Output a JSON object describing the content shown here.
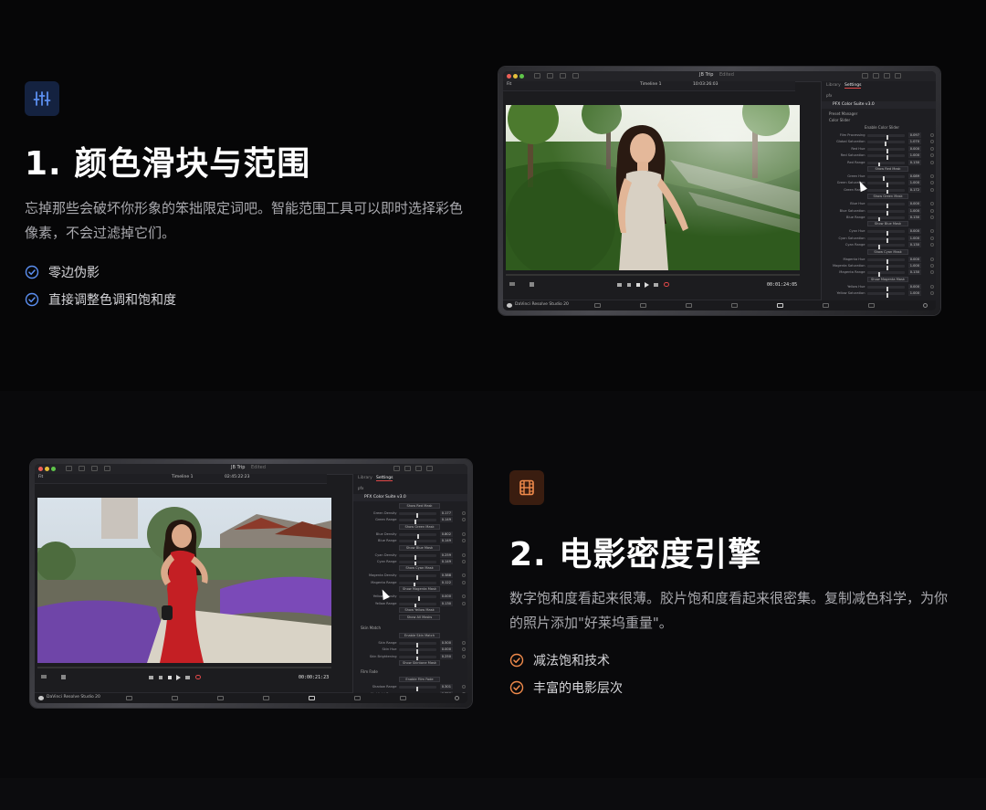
{
  "feature1": {
    "title": "1. 颜色滑块与范围",
    "description": "忘掉那些会破坏你形象的笨拙限定词吧。智能范围工具可以即时选择彩色像素，不会过滤掉它们。",
    "bullets": [
      "零边伪影",
      "直接调整色调和饱和度"
    ],
    "icon": "sliders-icon",
    "icon_color": "#5b8ff0",
    "icon_bg": "#142240",
    "check_color": "#5b8ff0"
  },
  "feature2": {
    "title": "2. 电影密度引擎",
    "description": "数字饱和度看起来很薄。胶片饱和度看起来很密集。复制减色科学，为你的照片添加\"好莱坞重量\"。",
    "bullets": [
      "减法饱和技术",
      "丰富的电影层次"
    ],
    "icon": "film-icon",
    "icon_color": "#f08a4b",
    "icon_bg": "#3a1d10",
    "check_color": "#f08a4b"
  },
  "app1": {
    "window_title": "JB Trip",
    "window_subtitle": "Edited",
    "timeline": "Timeline 1",
    "timecode_top": "10:03:26:03",
    "timecode": "00:01:24:05",
    "app_name": "DaVinci Resolve Studio 20",
    "tab_library": "Library",
    "tab_settings": "Settings",
    "fx_label": "pfx",
    "plugin_title": "PFX Color Suite v3.0",
    "preset_label": "Preset Manager",
    "section_label": "Color Slider",
    "enable_label": "Enable Color Slider",
    "rows": [
      {
        "label": "Film Processing",
        "value": "0.097"
      },
      {
        "label": "Global Saturation",
        "value": "1.070"
      },
      {
        "label": "Red Hue",
        "value": "0.000"
      },
      {
        "label": "Red Saturation",
        "value": "1.000"
      },
      {
        "label": "Red Range",
        "value": "0.130"
      },
      {
        "label": "Green Hue",
        "value": "0.089"
      },
      {
        "label": "Green Saturation",
        "value": "1.000"
      },
      {
        "label": "Green Range",
        "value": "0.172"
      },
      {
        "label": "Blue Hue",
        "value": "0.000"
      },
      {
        "label": "Blue Saturation",
        "value": "1.000"
      },
      {
        "label": "Blue Range",
        "value": "0.130"
      },
      {
        "label": "Cyan Hue",
        "value": "0.000"
      },
      {
        "label": "Cyan Saturation",
        "value": "1.000"
      },
      {
        "label": "Cyan Range",
        "value": "0.130"
      },
      {
        "label": "Magenta Hue",
        "value": "0.000"
      },
      {
        "label": "Magenta Saturation",
        "value": "1.000"
      },
      {
        "label": "Magenta Range",
        "value": "0.130"
      },
      {
        "label": "Yellow Hue",
        "value": "0.000"
      },
      {
        "label": "Yellow Saturation",
        "value": "1.000"
      }
    ],
    "masks": [
      "Show Red Mask",
      "Show Green Mask",
      "Show Blue Mask",
      "Show Cyan Mask",
      "Show Magenta Mask"
    ]
  },
  "app2": {
    "window_title": "JB Trip",
    "window_subtitle": "Edited",
    "timeline": "Timeline 1",
    "timecode_top": "02:45:22:23",
    "timecode": "00:00:21:23",
    "app_name": "DaVinci Resolve Studio 20",
    "tab_library": "Library",
    "tab_settings": "Settings",
    "fx_label": "pfx",
    "plugin_title": "PFX Color Suite v3.0",
    "rows": [
      {
        "label": "Green Density",
        "value": "0.177"
      },
      {
        "label": "Green Range",
        "value": "0.149"
      },
      {
        "label": "Blue Density",
        "value": "0.802"
      },
      {
        "label": "Blue Range",
        "value": "0.149"
      },
      {
        "label": "Cyan Density",
        "value": "0.259"
      },
      {
        "label": "Cyan Range",
        "value": "0.149"
      },
      {
        "label": "Magenta Density",
        "value": "0.388"
      },
      {
        "label": "Magenta Range",
        "value": "0.122"
      },
      {
        "label": "Yellow Density",
        "value": "0.000"
      },
      {
        "label": "Yellow Range",
        "value": "0.130"
      }
    ],
    "masks": [
      "Show Red Mask",
      "Show Green Mask",
      "Show Blue Mask",
      "Show Cyan Mask",
      "Show Magenta Mask",
      "Show Yellow Mask",
      "Show All Masks"
    ],
    "sections": [
      "Skin Match",
      "Film Fade"
    ],
    "enable_skin": "Enable Skin Match",
    "skin_rows": [
      {
        "label": "Skin Range",
        "value": "0.500"
      },
      {
        "label": "Skin Hue",
        "value": "0.000"
      },
      {
        "label": "Skin Brightening",
        "value": "0.250"
      }
    ],
    "skin_mask": "Show Skintone Mask",
    "enable_fade": "Enable Film Fade",
    "fade_rows": [
      {
        "label": "Shadow Range",
        "value": "0.301"
      },
      {
        "label": "Highlight Range",
        "value": "0.750"
      }
    ]
  }
}
